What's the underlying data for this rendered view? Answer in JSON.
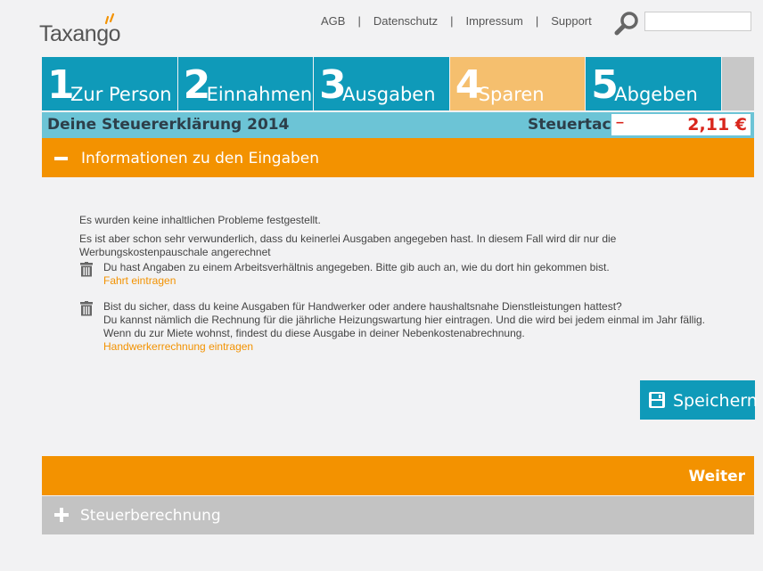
{
  "header": {
    "logo_text": "Taxango",
    "nav": [
      "AGB",
      "Datenschutz",
      "Impressum",
      "Support"
    ],
    "nav_separator": "|",
    "search_placeholder": ""
  },
  "steps": [
    {
      "num": "1",
      "label": "Zur Person"
    },
    {
      "num": "2",
      "label": "Einnahmen"
    },
    {
      "num": "3",
      "label": "Ausgaben"
    },
    {
      "num": "4",
      "label": "Sparen"
    },
    {
      "num": "5",
      "label": "Abgeben"
    }
  ],
  "active_step": "4",
  "titlebar": {
    "title": "Deine Steuererklärung 2014",
    "tacho_label": "Steuertacho",
    "tacho_sign": "–",
    "tacho_value": "2,11 €"
  },
  "info_section": {
    "label": "Informationen zu den Eingaben"
  },
  "content": {
    "line1": "Es wurden keine inhaltlichen Probleme festgestellt.",
    "line2": "Es ist aber schon sehr verwunderlich, dass du keinerlei Ausgaben angegeben hast. In diesem Fall wird dir nur die Werbungskostenpauschale angerechnet",
    "item1_text": "Du hast Angaben zu einem Arbeitsverhältnis angegeben. Bitte gib auch an, wie du dort hin gekommen bist.",
    "item1_link": "Fahrt eintragen",
    "item2_line1": "Bist du sicher, dass du keine Ausgaben für Handwerker oder andere haushaltsnahe Dienstleistungen hattest?",
    "item2_line2": "Du kannst nämlich die Rechnung für die jährliche Heizungswartung hier eintragen. Und die wird bei jedem einmal im Jahr fällig.",
    "item2_line3": "Wenn du zur Miete wohnst, findest du diese Ausgabe in deiner Nebenkostenabrechnung.",
    "item2_link": "Handwerkerrechnung eintragen"
  },
  "buttons": {
    "save": "Speichern",
    "next": "Weiter"
  },
  "calc_section": {
    "label": "Steuerberechnung"
  },
  "colors": {
    "teal": "#0f9ab9",
    "orange": "#f39200",
    "active_step": "#f5bf6e",
    "titlebar": "#6cc4d6",
    "gray": "#c3c3c3",
    "red": "#d9261c"
  }
}
